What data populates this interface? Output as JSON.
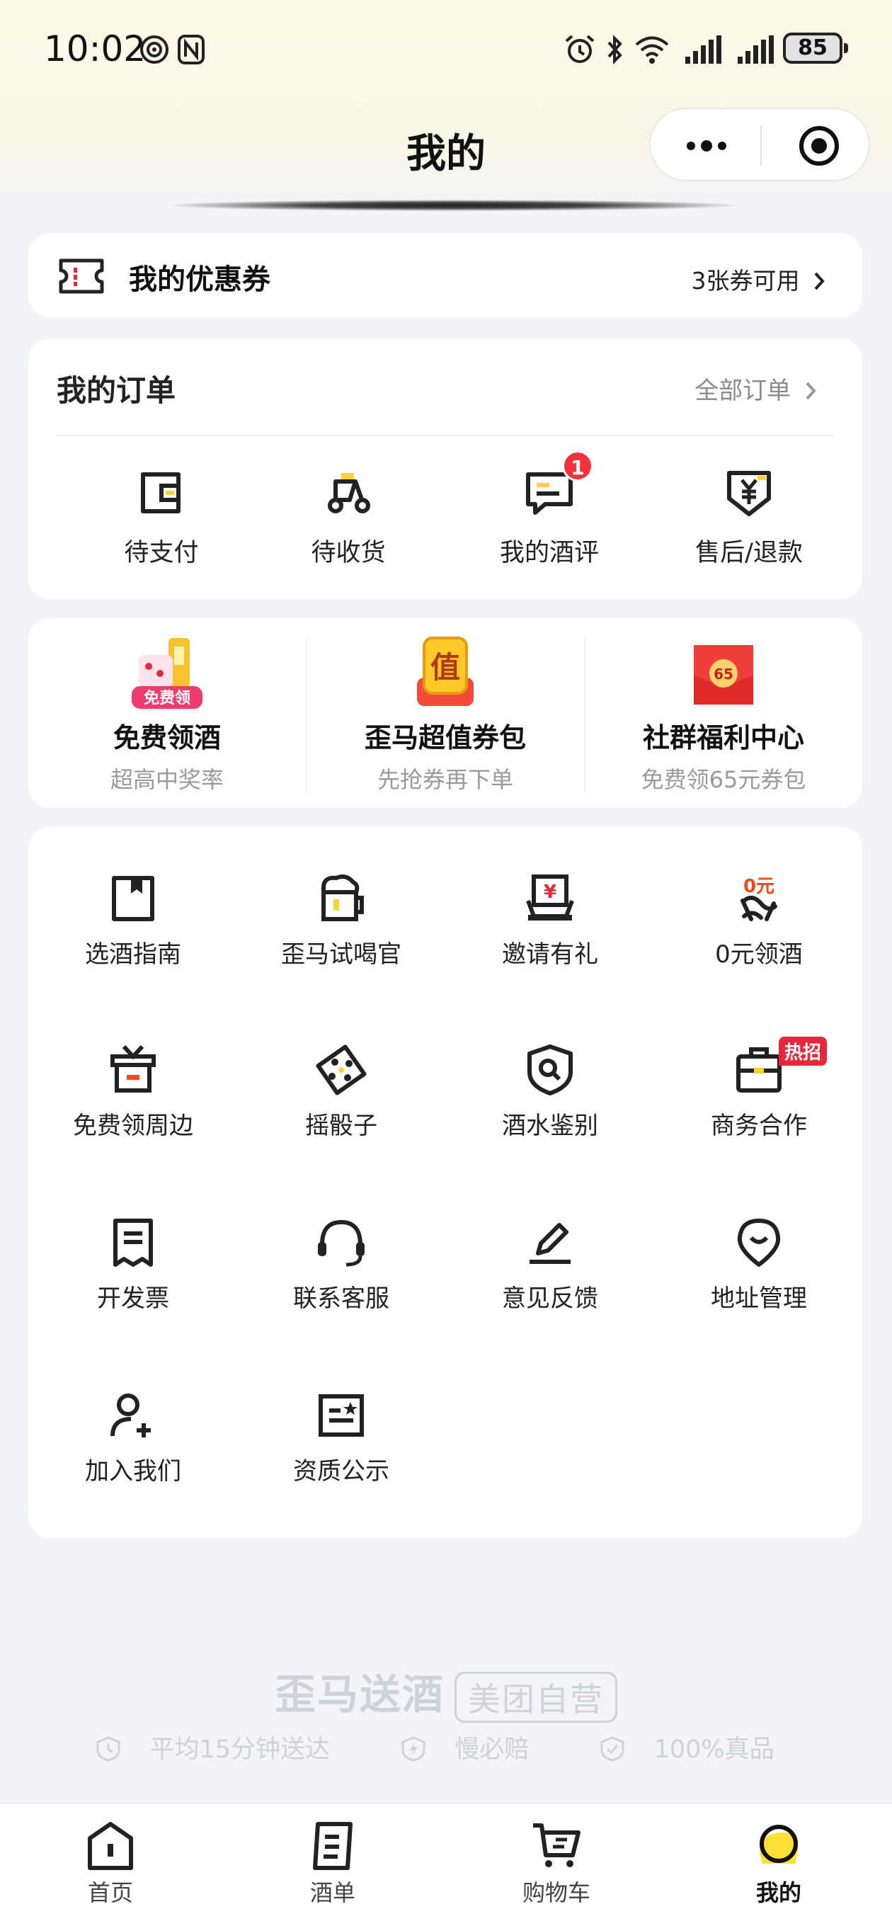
{
  "status_bar": {
    "time": "10:02",
    "battery": "85"
  },
  "nav": {
    "title": "我的"
  },
  "coupon": {
    "title": "我的优惠券",
    "available": "3张券可用"
  },
  "orders": {
    "title": "我的订单",
    "all_label": "全部订单",
    "items": [
      {
        "label": "待支付",
        "icon": "wallet-icon"
      },
      {
        "label": "待收货",
        "icon": "delivery-scooter-icon"
      },
      {
        "label": "我的酒评",
        "icon": "comment-icon",
        "badge": "1"
      },
      {
        "label": "售后/退款",
        "icon": "refund-shield-icon"
      }
    ]
  },
  "promos": [
    {
      "title": "免费领酒",
      "subtitle": "超高中奖率",
      "icon_text": "免费领"
    },
    {
      "title": "歪马超值券包",
      "subtitle": "先抢券再下单",
      "icon_text": "值"
    },
    {
      "title": "社群福利中心",
      "subtitle": "免费领65元券包",
      "icon_text": "65"
    }
  ],
  "services": [
    {
      "label": "选酒指南",
      "icon": "guide-book-icon"
    },
    {
      "label": "歪马试喝官",
      "icon": "beer-mug-icon"
    },
    {
      "label": "邀请有礼",
      "icon": "invite-gift-icon"
    },
    {
      "label": "0元领酒",
      "icon": "free-wine-icon",
      "icon_text": "0元"
    },
    {
      "label": "免费领周边",
      "icon": "tv-gift-icon"
    },
    {
      "label": "摇骰子",
      "icon": "dice-icon"
    },
    {
      "label": "酒水鉴别",
      "icon": "shield-search-icon"
    },
    {
      "label": "商务合作",
      "icon": "briefcase-icon",
      "tag": "热招"
    },
    {
      "label": "开发票",
      "icon": "invoice-icon"
    },
    {
      "label": "联系客服",
      "icon": "headset-icon"
    },
    {
      "label": "意见反馈",
      "icon": "pen-icon"
    },
    {
      "label": "地址管理",
      "icon": "location-icon"
    },
    {
      "label": "加入我们",
      "icon": "add-user-icon"
    },
    {
      "label": "资质公示",
      "icon": "certificate-icon"
    }
  ],
  "brand": {
    "name": "歪马送酒",
    "tag": "美团自营",
    "features": [
      "平均15分钟送达",
      "慢必赔",
      "100%真品"
    ]
  },
  "tabbar": {
    "items": [
      {
        "label": "首页",
        "icon": "home-icon"
      },
      {
        "label": "酒单",
        "icon": "menu-list-icon"
      },
      {
        "label": "购物车",
        "icon": "cart-icon"
      },
      {
        "label": "我的",
        "icon": "profile-icon",
        "active": true
      }
    ]
  },
  "colors": {
    "accent_yellow": "#ffd23c",
    "badge_red": "#f5323c",
    "page_bg": "#f3f4f8"
  }
}
